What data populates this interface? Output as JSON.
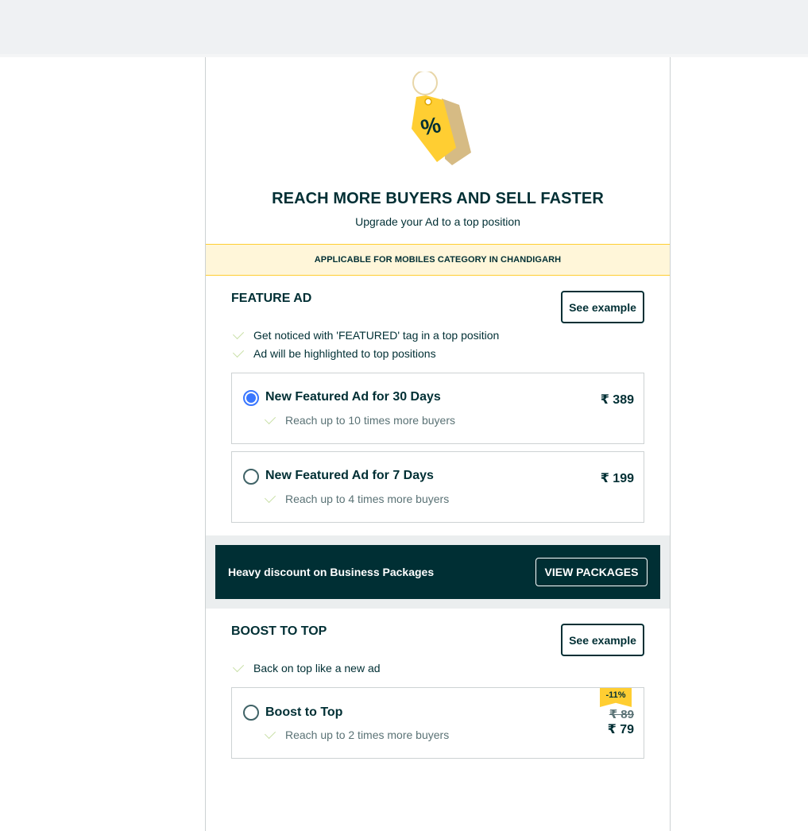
{
  "header": {
    "tag_icon": "percent-tag-icon",
    "title": "REACH MORE BUYERS AND SELL FASTER",
    "subtitle": "Upgrade your Ad to a top position"
  },
  "applicable_banner": "APPLICABLE FOR MOBILES CATEGORY IN CHANDIGARH",
  "feature_ad": {
    "title": "FEATURE AD",
    "see_example": "See example",
    "benefits": [
      "Get noticed with 'FEATURED' tag in a top position",
      "Ad will be highlighted to top positions"
    ],
    "options": [
      {
        "title": "New Featured Ad for 30 Days",
        "reach": "Reach up to 10 times more buyers",
        "price": "₹ 389",
        "selected": true
      },
      {
        "title": "New Featured Ad for 7 Days",
        "reach": "Reach up to 4 times more buyers",
        "price": "₹ 199",
        "selected": false
      }
    ]
  },
  "promo": {
    "text": "Heavy discount on Business Packages",
    "button": "VIEW PACKAGES"
  },
  "boost": {
    "title": "BOOST TO TOP",
    "see_example": "See example",
    "benefits": [
      "Back on top like a new ad"
    ],
    "option": {
      "title": "Boost to Top",
      "reach": "Reach up to 2 times more buyers",
      "discount": "-11%",
      "old_price": "₹ 89",
      "price": "₹ 79",
      "selected": false
    }
  },
  "colors": {
    "primary": "#002f34",
    "accent_yellow": "#ffce32",
    "banner_bg": "#fff6d9",
    "radio_selected": "#3a77ff",
    "check": "#c9dfa7"
  }
}
